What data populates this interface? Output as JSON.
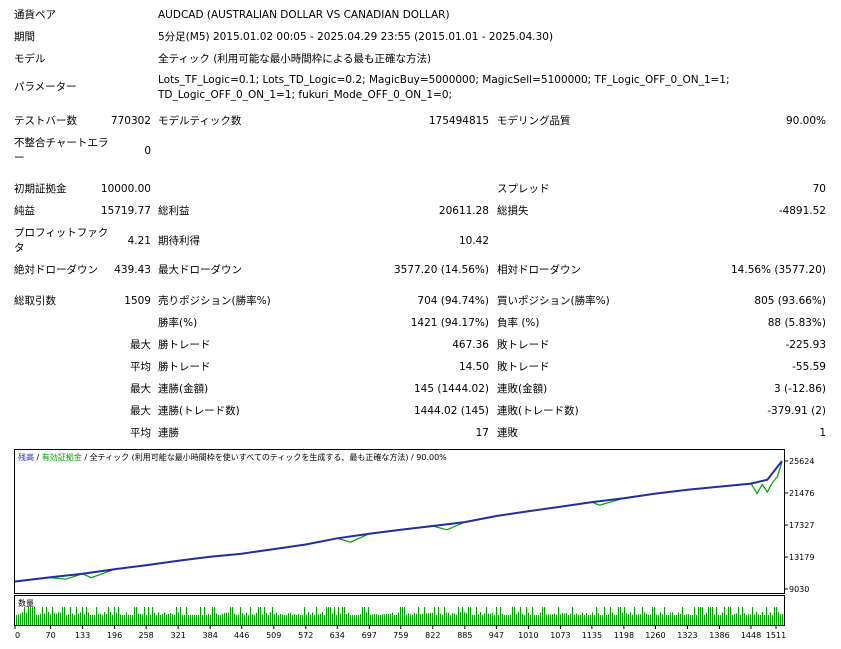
{
  "meta": {
    "symbol_label": "通貨ペア",
    "symbol": "AUDCAD (AUSTRALIAN DOLLAR VS CANADIAN DOLLAR)",
    "period_label": "期間",
    "period": "5分足(M5) 2015.01.02 00:05 - 2025.04.29 23:55 (2015.01.01 - 2025.04.30)",
    "model_label": "モデル",
    "model": "全ティック (利用可能な最小時間枠による最も正確な方法)",
    "params_label": "パラメーター",
    "params": "Lots_TF_Logic=0.1; Lots_TD_Logic=0.2; MagicBuy=5000000; MagicSell=5100000; TF_Logic_OFF_0_ON_1=1; TD_Logic_OFF_0_ON_1=1; fukuri_Mode_OFF_0_ON_1=0;"
  },
  "stats": {
    "bars_label": "テストバー数",
    "bars": "770302",
    "ticks_label": "モデルティック数",
    "ticks": "175494815",
    "quality_label": "モデリング品質",
    "quality": "90.00%",
    "mismatch_label": "不整合チャートエラー",
    "mismatch": "0",
    "deposit_label": "初期証拠金",
    "deposit": "10000.00",
    "spread_label": "スプレッド",
    "spread": "70",
    "net_label": "純益",
    "net": "15719.77",
    "gross_profit_label": "総利益",
    "gross_profit": "20611.28",
    "gross_loss_label": "総損失",
    "gross_loss": "-4891.52",
    "pf_label": "プロフィットファクタ",
    "pf": "4.21",
    "expected_label": "期待利得",
    "expected": "10.42",
    "abs_dd_label": "絶対ドローダウン",
    "abs_dd": "439.43",
    "max_dd_label": "最大ドローダウン",
    "max_dd": "3577.20 (14.56%)",
    "rel_dd_label": "相対ドローダウン",
    "rel_dd": "14.56% (3577.20)",
    "trades_label": "総取引数",
    "trades": "1509",
    "short_label": "売りポジション(勝率%)",
    "short": "704 (94.74%)",
    "long_label": "買いポジション(勝率%)",
    "long": "805 (93.66%)",
    "win_rate_label": "勝率(%)",
    "win_rate": "1421 (94.17%)",
    "loss_rate_label": "負率 (%)",
    "loss_rate": "88 (5.83%)",
    "max_word": "最大",
    "avg_word": "平均",
    "win_trade_label": "勝トレード",
    "max_win": "467.36",
    "loss_trade_label": "敗トレード",
    "max_loss": "-225.93",
    "avg_win": "14.50",
    "avg_loss": "-55.59",
    "cons_win_amt_label": "連勝(金額)",
    "cons_win_amt": "145 (1444.02)",
    "cons_loss_amt_label": "連敗(金額)",
    "cons_loss_amt": "3 (-12.86)",
    "cons_win_cnt_label": "連勝(トレード数)",
    "cons_win_cnt": "1444.02 (145)",
    "cons_loss_cnt_label": "連敗(トレード数)",
    "cons_loss_cnt": "-379.91 (2)",
    "avg_cons_win_label": "連勝",
    "avg_cons_win": "17",
    "avg_cons_loss_label": "連敗",
    "avg_cons_loss": "1"
  },
  "chart_data": {
    "type": "line",
    "legend": [
      {
        "text": "残高",
        "color": "#1f2ea3"
      },
      {
        "text": " / ",
        "color": "#000000"
      },
      {
        "text": "有効証拠金",
        "color": "#00a000"
      },
      {
        "text": " / 全ティック (利用可能な最小時間枠を使いすべてのティックを生成する、最も正確な方法) / 90.00%",
        "color": "#000000"
      }
    ],
    "y_ticks": [
      25624,
      21476,
      17327,
      13179,
      9030
    ],
    "ylim": [
      9030,
      25624
    ],
    "x_ticks": [
      0,
      70,
      133,
      196,
      258,
      321,
      384,
      446,
      509,
      572,
      634,
      697,
      759,
      822,
      885,
      947,
      1010,
      1073,
      1135,
      1198,
      1260,
      1323,
      1386,
      1448,
      1511
    ],
    "xlim": [
      0,
      1509
    ],
    "volume_label": "数量",
    "series": [
      {
        "color": "#1f2ea3",
        "x": [
          0,
          70,
          133,
          196,
          258,
          321,
          384,
          446,
          509,
          572,
          634,
          697,
          759,
          822,
          885,
          947,
          1010,
          1073,
          1135,
          1198,
          1260,
          1323,
          1386,
          1448,
          1480,
          1509
        ],
        "y": [
          10000,
          10550,
          11000,
          11600,
          12100,
          12700,
          13200,
          13600,
          14200,
          14800,
          15600,
          16200,
          16700,
          17200,
          17700,
          18500,
          19100,
          19700,
          20300,
          20800,
          21400,
          21900,
          22300,
          22700,
          23200,
          25624
        ]
      },
      {
        "color": "#00a000",
        "x": [
          0,
          70,
          100,
          133,
          150,
          196,
          258,
          321,
          384,
          446,
          509,
          572,
          634,
          660,
          697,
          759,
          822,
          850,
          885,
          947,
          1010,
          1073,
          1135,
          1150,
          1198,
          1260,
          1323,
          1386,
          1448,
          1460,
          1470,
          1480,
          1490,
          1500,
          1509
        ],
        "y": [
          10000,
          10500,
          10300,
          11000,
          10500,
          11600,
          12100,
          12700,
          13200,
          13600,
          14200,
          14800,
          15600,
          15100,
          16200,
          16700,
          17200,
          16700,
          17700,
          18500,
          19100,
          19700,
          20300,
          19900,
          20800,
          21400,
          21900,
          22300,
          22700,
          21400,
          22600,
          21600,
          22800,
          23600,
          25500
        ]
      }
    ]
  }
}
